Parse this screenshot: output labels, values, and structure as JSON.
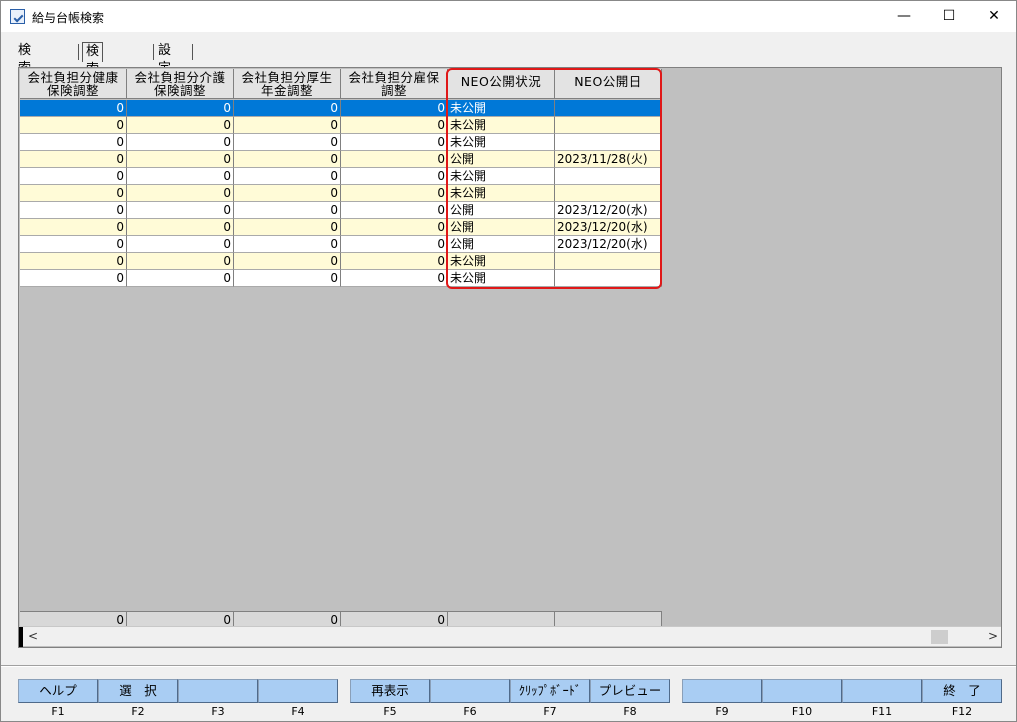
{
  "window": {
    "title": "給与台帳検索",
    "minimize": "—",
    "maximize": "☐",
    "close": "✕"
  },
  "tabs": [
    {
      "label": "検索条件"
    },
    {
      "label": "検索結果"
    },
    {
      "label": "設定"
    }
  ],
  "grid": {
    "columns": [
      {
        "label1": "会社負担分健康",
        "label2": "保険調整"
      },
      {
        "label1": "会社負担分介護",
        "label2": "保険調整"
      },
      {
        "label1": "会社負担分厚生",
        "label2": "年金調整"
      },
      {
        "label1": "会社負担分雇保",
        "label2": "調整"
      },
      {
        "label1": "NEO公開状況",
        "label2": ""
      },
      {
        "label1": "NEO公開日",
        "label2": ""
      }
    ],
    "rows": [
      {
        "c1": "0",
        "c2": "0",
        "c3": "0",
        "c4": "0",
        "status": "未公開",
        "date": ""
      },
      {
        "c1": "0",
        "c2": "0",
        "c3": "0",
        "c4": "0",
        "status": "未公開",
        "date": ""
      },
      {
        "c1": "0",
        "c2": "0",
        "c3": "0",
        "c4": "0",
        "status": "未公開",
        "date": ""
      },
      {
        "c1": "0",
        "c2": "0",
        "c3": "0",
        "c4": "0",
        "status": "公開",
        "date": "2023/11/28(火)"
      },
      {
        "c1": "0",
        "c2": "0",
        "c3": "0",
        "c4": "0",
        "status": "未公開",
        "date": ""
      },
      {
        "c1": "0",
        "c2": "0",
        "c3": "0",
        "c4": "0",
        "status": "未公開",
        "date": ""
      },
      {
        "c1": "0",
        "c2": "0",
        "c3": "0",
        "c4": "0",
        "status": "公開",
        "date": "2023/12/20(水)"
      },
      {
        "c1": "0",
        "c2": "0",
        "c3": "0",
        "c4": "0",
        "status": "公開",
        "date": "2023/12/20(水)"
      },
      {
        "c1": "0",
        "c2": "0",
        "c3": "0",
        "c4": "0",
        "status": "公開",
        "date": "2023/12/20(水)"
      },
      {
        "c1": "0",
        "c2": "0",
        "c3": "0",
        "c4": "0",
        "status": "未公開",
        "date": ""
      },
      {
        "c1": "0",
        "c2": "0",
        "c3": "0",
        "c4": "0",
        "status": "未公開",
        "date": ""
      }
    ],
    "totals": [
      "0",
      "0",
      "0",
      "0",
      "",
      ""
    ]
  },
  "scrollbar": {
    "left": "<",
    "right": ">"
  },
  "fkeys": [
    {
      "label": "ヘルプ",
      "key": "F1"
    },
    {
      "label": "選　択",
      "key": "F2"
    },
    {
      "label": "",
      "key": "F3"
    },
    {
      "label": "",
      "key": "F4"
    },
    {
      "label": "再表示",
      "key": "F5"
    },
    {
      "label": "",
      "key": "F6"
    },
    {
      "label": "ｸﾘｯﾌﾟﾎﾞｰﾄﾞ",
      "key": "F7"
    },
    {
      "label": "プレビュー",
      "key": "F8"
    },
    {
      "label": "",
      "key": "F9"
    },
    {
      "label": "",
      "key": "F10"
    },
    {
      "label": "",
      "key": "F11"
    },
    {
      "label": "終　了",
      "key": "F12"
    }
  ],
  "colors": {
    "selected_row": "#0078d7",
    "alt_row": "#fffbd7",
    "fkey_bg": "#a9cdf3",
    "highlight": "#e01818"
  }
}
